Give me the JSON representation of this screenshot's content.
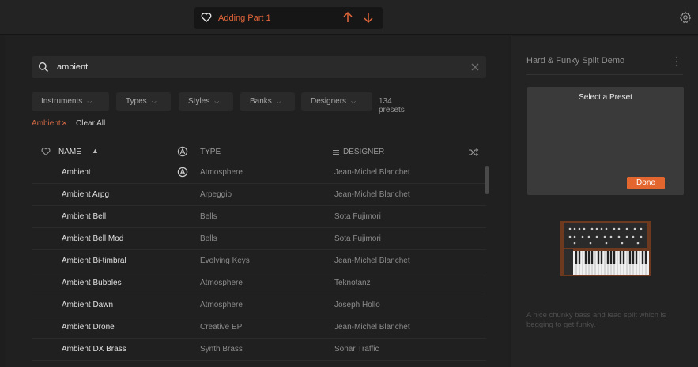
{
  "topbar": {
    "part_title": "Adding Part 1",
    "icons": [
      "heart-icon",
      "arrow-up-icon",
      "arrow-down-icon",
      "gear-icon"
    ],
    "accent_color": "#e4663a"
  },
  "search": {
    "value": "ambient",
    "icon": "search-icon"
  },
  "filters": [
    {
      "label": "Instruments"
    },
    {
      "label": "Types"
    },
    {
      "label": "Styles"
    },
    {
      "label": "Banks"
    },
    {
      "label": "Designers"
    }
  ],
  "count_label": "134 presets",
  "tags": {
    "active": "Ambient",
    "remove_symbol": "✕",
    "clear_all": "Clear All"
  },
  "table": {
    "columns": {
      "name": "NAME",
      "type": "TYPE",
      "designer": "DESIGNER"
    },
    "rows": [
      {
        "name": "Ambient",
        "type": "Atmosphere",
        "designer": "Jean-Michel Blanchet",
        "factory_icon": true
      },
      {
        "name": "Ambient Arpg",
        "type": "Arpeggio",
        "designer": "Jean-Michel Blanchet"
      },
      {
        "name": "Ambient Bell",
        "type": "Bells",
        "designer": "Sota Fujimori"
      },
      {
        "name": "Ambient Bell Mod",
        "type": "Bells",
        "designer": "Sota Fujimori"
      },
      {
        "name": "Ambient Bi-timbral",
        "type": "Evolving Keys",
        "designer": "Jean-Michel Blanchet"
      },
      {
        "name": "Ambient Bubbles",
        "type": "Atmosphere",
        "designer": "Teknotanz"
      },
      {
        "name": "Ambient Dawn",
        "type": "Atmosphere",
        "designer": "Joseph Hollo"
      },
      {
        "name": "Ambient Drone",
        "type": "Creative EP",
        "designer": "Jean-Michel Blanchet"
      },
      {
        "name": "Ambient DX Brass",
        "type": "Synth Brass",
        "designer": "Sonar Traffic"
      }
    ]
  },
  "right_panel": {
    "preset_title": "Hard & Funky Split Demo",
    "select_title": "Select a Preset",
    "done_label": "Done",
    "description": "A nice chunky bass and lead split which is begging to get funky."
  }
}
